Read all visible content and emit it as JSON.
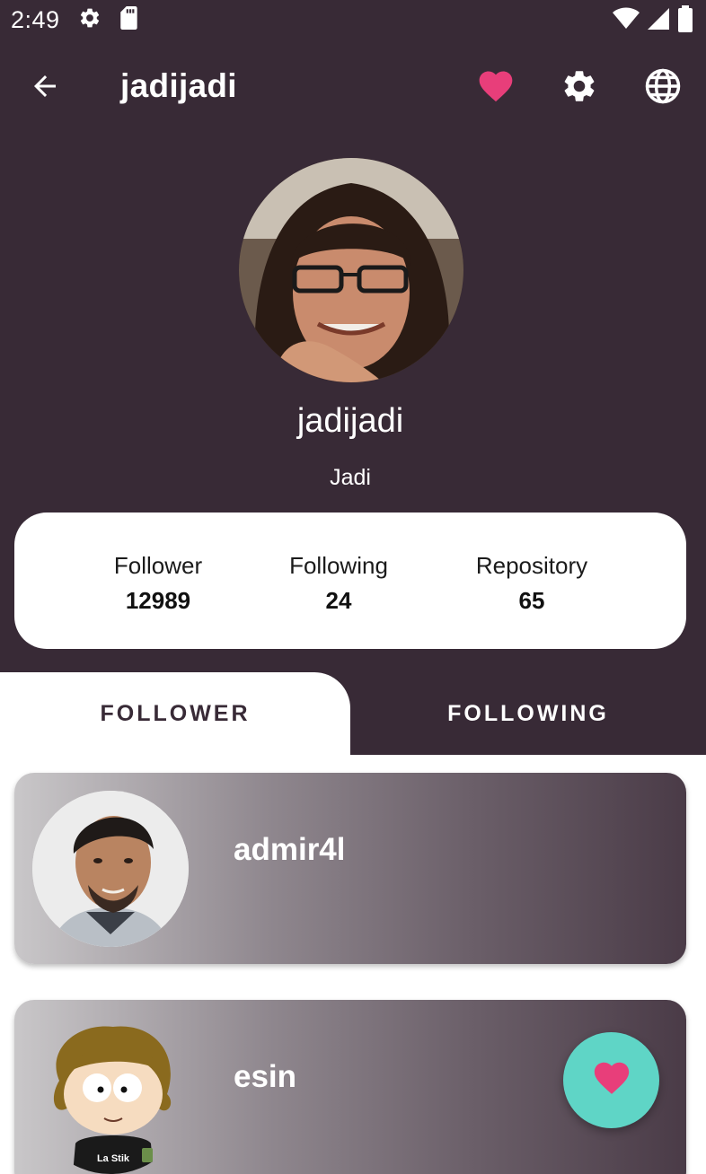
{
  "status_bar": {
    "time": "2:49",
    "left_icons": [
      "settings-icon",
      "sd-card-icon"
    ],
    "right_icons": [
      "wifi-icon",
      "signal-icon",
      "battery-icon"
    ]
  },
  "app_bar": {
    "title": "jadijadi",
    "actions": [
      "favorite-icon",
      "settings-icon",
      "globe-icon"
    ],
    "favorite_color": "#e83e7a"
  },
  "profile": {
    "username": "jadijadi",
    "name": "Jadi"
  },
  "stats": [
    {
      "label": "Follower",
      "value": "12989"
    },
    {
      "label": "Following",
      "value": "24"
    },
    {
      "label": "Repository",
      "value": "65"
    }
  ],
  "tabs": [
    {
      "label": "FOLLOWER",
      "active": true
    },
    {
      "label": "FOLLOWING",
      "active": false
    }
  ],
  "users": [
    {
      "username": "admir4l"
    },
    {
      "username": "esin"
    }
  ],
  "fab": {
    "icon": "favorite-icon",
    "color": "#5fd5c6"
  },
  "colors": {
    "primary_dark": "#382a36",
    "accent_pink": "#e83e7a",
    "fab_teal": "#5fd5c6"
  }
}
